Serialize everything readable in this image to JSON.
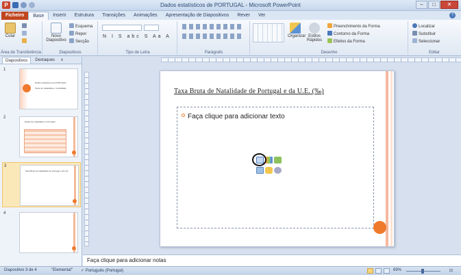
{
  "window": {
    "title": "Dados estatísticos de PORTUGAL - Microsoft PowerPoint",
    "app_icon": "P",
    "controls": {
      "minimize": "–",
      "maximize": "□",
      "close": "✕"
    }
  },
  "ribbon_tabs": [
    "Ficheiro",
    "Base",
    "Inserir",
    "Estrutura",
    "Transições",
    "Animações",
    "Apresentação de Diapositivos",
    "Rever",
    "Ver"
  ],
  "ribbon": {
    "clipboard": {
      "paste": "Colar",
      "label": "Área de Transferência"
    },
    "slides": {
      "new_slide": "Novo Diapositivo",
      "layout": "Esquema",
      "reset": "Repor",
      "section": "Secção",
      "label": "Diapositivos"
    },
    "font": {
      "label": "Tipo de Letra",
      "format_row": "N I S abc S Aa A"
    },
    "paragraph": {
      "label": "Parágrafo"
    },
    "drawing": {
      "arrange": "Organizar",
      "quick_styles": "Estilos Rápidos",
      "fill": "Preenchimento da Forma",
      "outline": "Contorno da Forma",
      "effects": "Efeitos da Forma",
      "label": "Desenho"
    },
    "editing": {
      "find": "Localizar",
      "replace": "Substituir",
      "select": "Seleccionar",
      "label": "Editar"
    }
  },
  "left_panel": {
    "tabs": {
      "slides": "Diapositivos",
      "outline": "Destaques",
      "close": "x"
    },
    "thumbnails": [
      {
        "num": "1",
        "title": "Dados estatísticos de PORTUGAL",
        "subtitle": "Taxas de natalidade e mortalidade"
      },
      {
        "num": "2",
        "title": "Dados de natalidade em Portugal"
      },
      {
        "num": "3",
        "title": "Taxa Bruta de Natalidade de Portugal e da U.E."
      },
      {
        "num": "4"
      }
    ]
  },
  "slide": {
    "title": "Taxa Bruta de Natalidade de Portugal e da U.E. (‰)",
    "placeholder": "Faça clique para adicionar texto",
    "content_icons": [
      "table-icon",
      "chart-icon",
      "smartart-icon",
      "picture-icon",
      "clipart-icon",
      "media-icon"
    ]
  },
  "notes": {
    "placeholder": "Faça clique para adicionar notas"
  },
  "status": {
    "slide_counter": "Diapositivo 3 de 4",
    "theme": "\"Elemental\"",
    "language": "Português (Portugal)",
    "zoom": "69%"
  },
  "colors": {
    "accent": "#f07a2c",
    "file_tab": "#c0461f",
    "ribbon_bg": "#dfe8f3"
  }
}
